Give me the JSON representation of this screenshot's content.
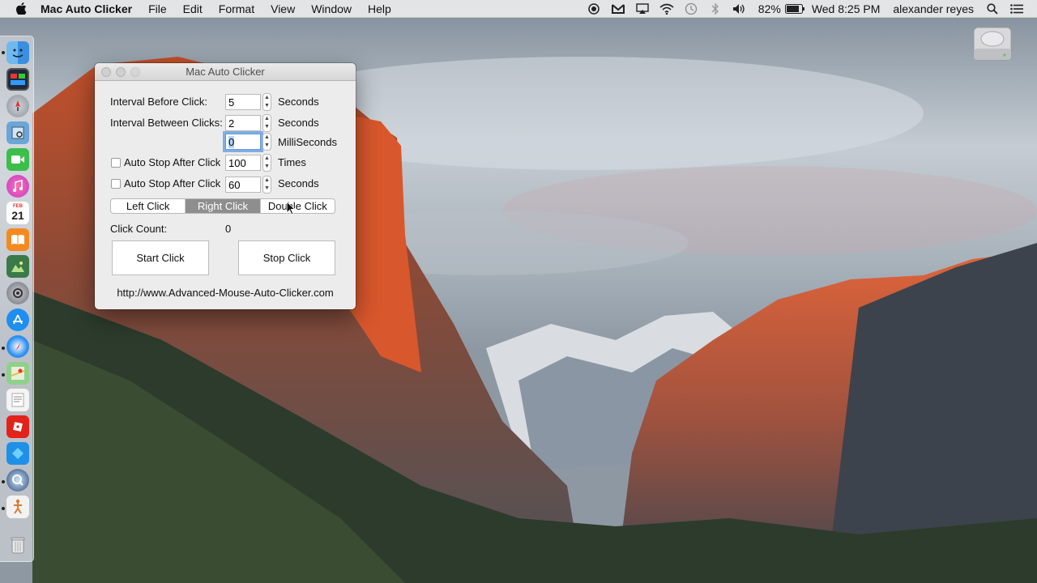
{
  "menubar": {
    "app_name": "Mac Auto Clicker",
    "menus": [
      "File",
      "Edit",
      "Format",
      "View",
      "Window",
      "Help"
    ],
    "battery_percent": "82%",
    "datetime": "Wed 8:25 PM",
    "user": "alexander reyes",
    "icons": [
      "apple-icon",
      "record-icon",
      "gmail-icon",
      "airplay-icon",
      "wifi-icon",
      "time-machine-icon",
      "bluetooth-icon",
      "volume-icon",
      "battery-icon",
      "spotlight-icon",
      "notification-center-icon"
    ]
  },
  "dock": {
    "items": [
      "finder-icon",
      "mission-control-icon",
      "launchpad-icon",
      "preview-icon",
      "facetime-icon",
      "itunes-icon",
      "calendar-icon",
      "ibooks-icon",
      "photos-icon",
      "system-preferences-icon",
      "app-store-icon",
      "safari-icon",
      "maps-icon",
      "textedit-icon",
      "roblox-icon",
      "cube-app-icon",
      "quicktime-icon",
      "auto-clicker-icon",
      "trash-icon"
    ],
    "calendar_day": "21"
  },
  "window": {
    "title": "Mac Auto Clicker",
    "interval_before_label": "Interval Before Click:",
    "interval_before_value": "5",
    "interval_before_unit": "Seconds",
    "interval_between_label": "Interval Between Clicks:",
    "interval_between_value": "2",
    "interval_between_unit": "Seconds",
    "milliseconds_value": "0",
    "milliseconds_unit": "MilliSeconds",
    "auto_stop_clicks_label": "Auto Stop After Click",
    "auto_stop_clicks_value": "100",
    "auto_stop_clicks_unit": "Times",
    "auto_stop_time_label": "Auto Stop After Click",
    "auto_stop_time_value": "60",
    "auto_stop_time_unit": "Seconds",
    "click_types": [
      "Left Click",
      "Right Click",
      "Double Click"
    ],
    "selected_click_type": "Right Click",
    "click_count_label": "Click Count:",
    "click_count_value": "0",
    "start_button": "Start  Click",
    "stop_button": "Stop  Click",
    "url": "http://www.Advanced-Mouse-Auto-Clicker.com"
  }
}
